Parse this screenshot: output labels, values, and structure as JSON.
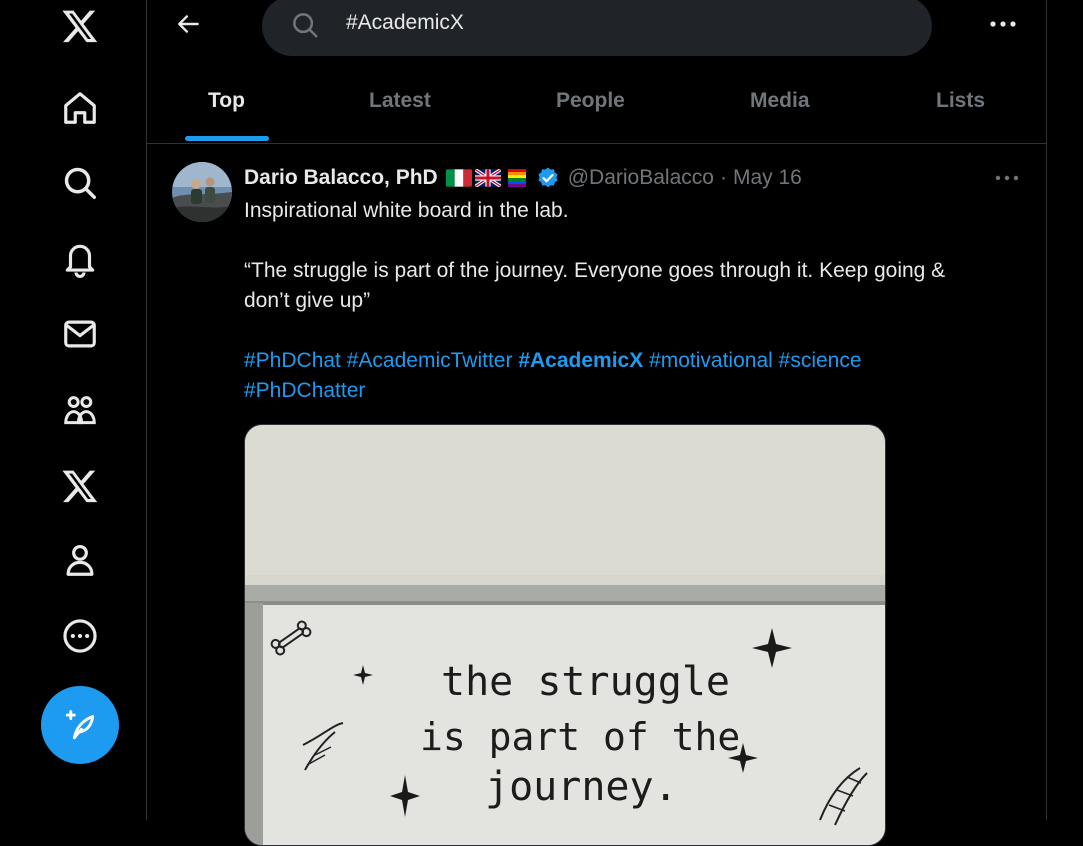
{
  "nav": {
    "items": [
      {
        "name": "x-logo-icon"
      },
      {
        "name": "home-icon"
      },
      {
        "name": "explore-icon"
      },
      {
        "name": "notifications-icon"
      },
      {
        "name": "messages-icon"
      },
      {
        "name": "communities-icon"
      },
      {
        "name": "premium-x-icon"
      },
      {
        "name": "profile-icon"
      },
      {
        "name": "more-icon"
      }
    ],
    "compose_icon": "compose-post-icon"
  },
  "search": {
    "value": "#AcademicX"
  },
  "tabs": [
    {
      "label": "Top",
      "active": true
    },
    {
      "label": "Latest",
      "active": false
    },
    {
      "label": "People",
      "active": false
    },
    {
      "label": "Media",
      "active": false
    },
    {
      "label": "Lists",
      "active": false
    }
  ],
  "tweet": {
    "name": "Dario Balacco, PhD",
    "flags": [
      "italy-flag",
      "uk-flag",
      "rainbow-flag"
    ],
    "handle": "@DarioBalacco",
    "separator": "·",
    "date": "May 16",
    "text_line1": "Inspirational white board in the lab.",
    "quote_line1": "“The struggle is part of the journey. Everyone goes through it. Keep going &",
    "quote_line2": "don’t give up”",
    "hashtags": [
      "#PhDChat",
      "#AcademicTwitter",
      "#AcademicX",
      "#motivational",
      "#science",
      "#PhDChatter"
    ],
    "media": {
      "board_line1": "the struggle",
      "board_line2": "is part of the",
      "board_line3": "journey."
    }
  },
  "colors": {
    "accent": "#1d9bf0",
    "muted": "#71767b",
    "text": "#e7e9ea",
    "border": "#2f3336"
  }
}
